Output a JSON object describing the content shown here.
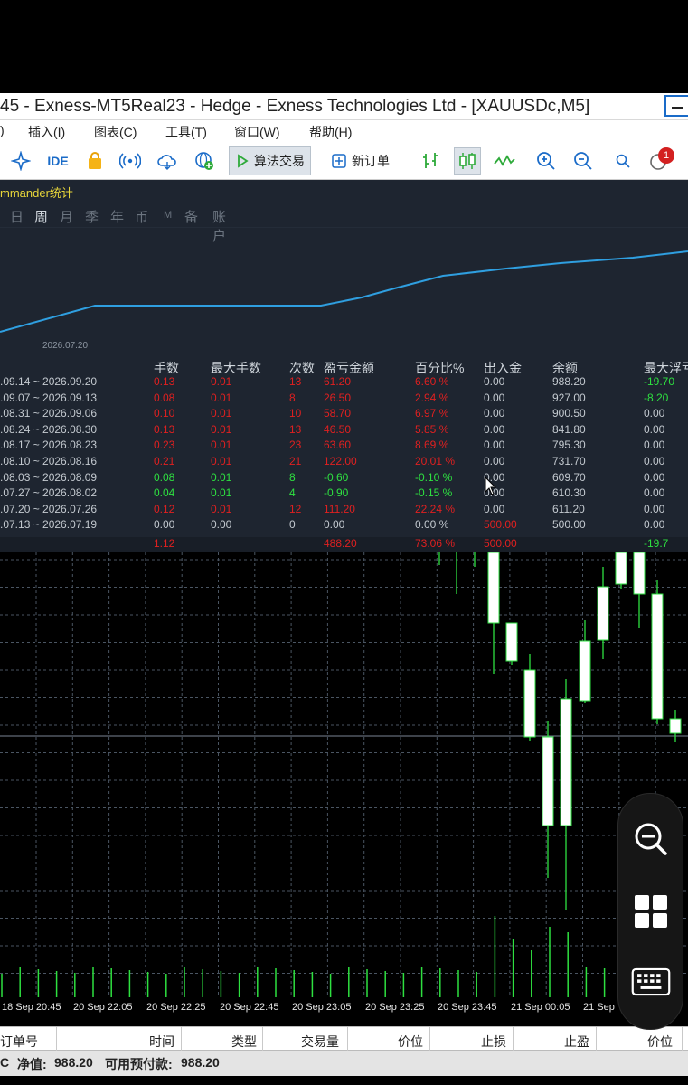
{
  "window": {
    "title": "45 - Exness-MT5Real23 - Hedge - Exness Technologies Ltd - [XAUUSDc,M5]"
  },
  "menu": {
    "items": [
      "插入(I)",
      "图表(C)",
      "工具(T)",
      "窗口(W)",
      "帮助(H)"
    ],
    "left_fragment": ")"
  },
  "toolbar": {
    "ide_label": "IDE",
    "algo_trading_label": "算法交易",
    "new_order_label": "新订单",
    "notification_count": "1"
  },
  "stats_panel": {
    "title": "mmander统计",
    "period_tabs": [
      "日",
      "周",
      "月",
      "季",
      "年",
      "币",
      "M",
      "备",
      "账户"
    ],
    "selected_tab": "周",
    "equity_axis_date": "2026.07.20",
    "headers": [
      "手数",
      "最大手数",
      "次数",
      "盈亏金额",
      "百分比%",
      "出入金",
      "余额",
      "最大浮亏"
    ],
    "rows": [
      {
        "period": ".09.14 ~ 2026.09.20",
        "lots": "0.13",
        "max_lots": "0.01",
        "count": "13",
        "pnl": "61.20",
        "pct": "6.60 %",
        "deposit": "0.00",
        "balance": "988.20",
        "max_float": "-19.70",
        "tone": "red",
        "float_tone": "green"
      },
      {
        "period": ".09.07 ~ 2026.09.13",
        "lots": "0.08",
        "max_lots": "0.01",
        "count": "8",
        "pnl": "26.50",
        "pct": "2.94 %",
        "deposit": "0.00",
        "balance": "927.00",
        "max_float": "-8.20",
        "tone": "red",
        "float_tone": "green"
      },
      {
        "period": ".08.31 ~ 2026.09.06",
        "lots": "0.10",
        "max_lots": "0.01",
        "count": "10",
        "pnl": "58.70",
        "pct": "6.97 %",
        "deposit": "0.00",
        "balance": "900.50",
        "max_float": "0.00",
        "tone": "red",
        "float_tone": "gray"
      },
      {
        "period": ".08.24 ~ 2026.08.30",
        "lots": "0.13",
        "max_lots": "0.01",
        "count": "13",
        "pnl": "46.50",
        "pct": "5.85 %",
        "deposit": "0.00",
        "balance": "841.80",
        "max_float": "0.00",
        "tone": "red",
        "float_tone": "gray"
      },
      {
        "period": ".08.17 ~ 2026.08.23",
        "lots": "0.23",
        "max_lots": "0.01",
        "count": "23",
        "pnl": "63.60",
        "pct": "8.69 %",
        "deposit": "0.00",
        "balance": "795.30",
        "max_float": "0.00",
        "tone": "red",
        "float_tone": "gray"
      },
      {
        "period": ".08.10 ~ 2026.08.16",
        "lots": "0.21",
        "max_lots": "0.01",
        "count": "21",
        "pnl": "122.00",
        "pct": "20.01 %",
        "deposit": "0.00",
        "balance": "731.70",
        "max_float": "0.00",
        "tone": "red",
        "float_tone": "gray"
      },
      {
        "period": ".08.03 ~ 2026.08.09",
        "lots": "0.08",
        "max_lots": "0.01",
        "count": "8",
        "pnl": "-0.60",
        "pct": "-0.10 %",
        "deposit": "0.00",
        "balance": "609.70",
        "max_float": "0.00",
        "tone": "green",
        "float_tone": "gray"
      },
      {
        "period": ".07.27 ~ 2026.08.02",
        "lots": "0.04",
        "max_lots": "0.01",
        "count": "4",
        "pnl": "-0.90",
        "pct": "-0.15 %",
        "deposit": "0.00",
        "balance": "610.30",
        "max_float": "0.00",
        "tone": "green",
        "float_tone": "gray"
      },
      {
        "period": ".07.20 ~ 2026.07.26",
        "lots": "0.12",
        "max_lots": "0.01",
        "count": "12",
        "pnl": "111.20",
        "pct": "22.24 %",
        "deposit": "0.00",
        "balance": "611.20",
        "max_float": "0.00",
        "tone": "red",
        "float_tone": "gray"
      },
      {
        "period": ".07.13 ~ 2026.07.19",
        "lots": "0.00",
        "max_lots": "0.00",
        "count": "0",
        "pnl": "0.00",
        "pct": "0.00 %",
        "deposit": "500.00",
        "balance": "500.00",
        "max_float": "0.00",
        "tone": "gray",
        "float_tone": "gray",
        "deposit_tone": "red"
      }
    ],
    "totals": {
      "lots": "1.12",
      "pnl": "488.20",
      "pct": "73.06 %",
      "deposit": "500.00",
      "max_float": "-19.7"
    }
  },
  "price_chart": {
    "time_labels": [
      "18 Sep 20:45",
      "20 Sep 22:05",
      "20 Sep 22:25",
      "20 Sep 22:45",
      "20 Sep 23:05",
      "20 Sep 23:25",
      "20 Sep 23:45",
      "21 Sep 00:05",
      "21 Sep"
    ],
    "candle_color": "#ffffff",
    "wick_color": "#2ee040",
    "grid_color": "#4a5562"
  },
  "trade_table": {
    "headers": [
      "订单号",
      "时间",
      "类型",
      "交易量",
      "价位",
      "止损",
      "止盈",
      "价位"
    ]
  },
  "status": {
    "prefix": "C",
    "equity_label": "净值:",
    "equity_value": "988.20",
    "free_margin_label": "可用预付款:",
    "free_margin_value": "988.20"
  },
  "colors": {
    "panel_bg": "#1e2530",
    "equity_line": "#2f9fe0",
    "title_yellow": "#e8d63a"
  }
}
